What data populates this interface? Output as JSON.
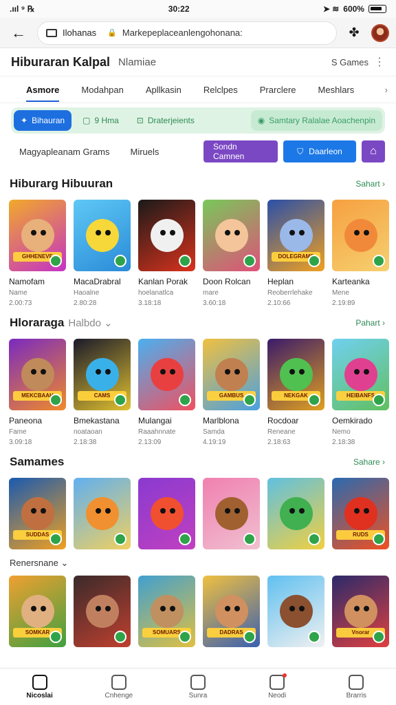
{
  "status": {
    "left": ".ııl ⁹ ℞",
    "time": "30:22",
    "right": "600%"
  },
  "browser": {
    "tab_title": "Ilohanas",
    "url": "Markepeplaceanlengohonana:",
    "back_icon": "arrow-left-icon",
    "extensions_icon": "puzzle-icon"
  },
  "site": {
    "title": "Hiburaran Kalpal",
    "subtitle": "Nlamiae",
    "count": "S Games",
    "menu_icon": "more-vertical-icon"
  },
  "tabs": [
    "Asmore",
    "Modahpan",
    "Apllkasin",
    "Relclpes",
    "Prarclere",
    "Meshlars"
  ],
  "chips": [
    {
      "label": "Bihauran",
      "style": "blue"
    },
    {
      "label": "9 Hma",
      "style": "plain"
    },
    {
      "label": "Draterjeients",
      "style": "plain"
    },
    {
      "label": "Samtary Ralalae Aoachenpin",
      "style": "soft"
    }
  ],
  "filter": {
    "left_a": "Magyapleanam Grams",
    "left_b": "Miruels",
    "btn_purple": "Sondn Camnen",
    "btn_blue": "Daarleon"
  },
  "sections": [
    {
      "title": "Hiburarg Hibuuran",
      "sub": "",
      "see_all": "Sahart ›",
      "games": [
        {
          "name": "Namofam",
          "sub": "Name",
          "meta": "2.00:73",
          "banner": "GHHENEVE",
          "bg1": "#f2a92a",
          "bg2": "#c433c4",
          "face": "#e8b07a"
        },
        {
          "name": "MacaDrabral",
          "sub": "Haoalne",
          "meta": "2.80:28",
          "banner": "",
          "bg1": "#5fc8f5",
          "bg2": "#2a8bd8",
          "face": "#f7d83a"
        },
        {
          "name": "Kanlan Porak",
          "sub": "hoelanatlca",
          "meta": "3.18:18",
          "banner": "",
          "bg1": "#1a1a1a",
          "bg2": "#d9321c",
          "face": "#f0f0f0"
        },
        {
          "name": "Doon Rolcan",
          "sub": "mare",
          "meta": "3.60:18",
          "banner": "",
          "bg1": "#78c85a",
          "bg2": "#e0507a",
          "face": "#f4c49a"
        },
        {
          "name": "Heplan",
          "sub": "Reoberrlehake",
          "meta": "2.10:66",
          "banner": "DOLEGRAMS",
          "bg1": "#2a4fa8",
          "bg2": "#f0a020",
          "face": "#9ab8e8"
        },
        {
          "name": "Karteanka",
          "sub": "Mene",
          "meta": "2.19:89",
          "banner": "",
          "bg1": "#f7a040",
          "bg2": "#f5d070",
          "face": "#f08a3a"
        }
      ]
    },
    {
      "title": "Hloraraga",
      "sub": "Halbdo ⌄",
      "see_all": "Pahart ›",
      "games": [
        {
          "name": "Paneona",
          "sub": "Fame",
          "meta": "3.09:18",
          "banner": "MEKCBAAH",
          "bg1": "#7a2ac0",
          "bg2": "#f08a2a",
          "face": "#c08a5a"
        },
        {
          "name": "Bmekastana",
          "sub": "noataoan",
          "meta": "2.18:38",
          "banner": "CAMS",
          "bg1": "#1a1a2a",
          "bg2": "#e0c030",
          "face": "#3ab0e8"
        },
        {
          "name": "Mulangai",
          "sub": "Raaahnnate",
          "meta": "2.13:09",
          "banner": "",
          "bg1": "#4ab0f0",
          "bg2": "#f05060",
          "face": "#e84040"
        },
        {
          "name": "Marlblona",
          "sub": "Samda",
          "meta": "4.19:19",
          "banner": "GAMBUS",
          "bg1": "#f0c040",
          "bg2": "#4aa0e0",
          "face": "#c08050"
        },
        {
          "name": "Rocdoar",
          "sub": "Reneane",
          "meta": "2.18:63",
          "banner": "NEKGAK",
          "bg1": "#3a1a6a",
          "bg2": "#e0a020",
          "face": "#50c050"
        },
        {
          "name": "Oemkirado",
          "sub": "Nemo",
          "meta": "2.18:38",
          "banner": "HEIBANFS",
          "bg1": "#70d0f0",
          "bg2": "#60c060",
          "face": "#e04090"
        }
      ]
    },
    {
      "title": "Samames",
      "sub": "",
      "see_all": "Sahare ›",
      "games": [
        {
          "name": "",
          "sub": "",
          "meta": "",
          "banner": "SUDDAS",
          "bg1": "#1a5ab0",
          "bg2": "#f0a020",
          "face": "#c07040"
        },
        {
          "name": "",
          "sub": "",
          "meta": "",
          "banner": "",
          "bg1": "#60b0f0",
          "bg2": "#f0d060",
          "face": "#f09030"
        },
        {
          "name": "",
          "sub": "",
          "meta": "",
          "banner": "",
          "bg1": "#8a3ad0",
          "bg2": "#c040c0",
          "face": "#f05030"
        },
        {
          "name": "",
          "sub": "",
          "meta": "",
          "banner": "",
          "bg1": "#f080b0",
          "bg2": "#f0c0d0",
          "face": "#a06030"
        },
        {
          "name": "",
          "sub": "",
          "meta": "",
          "banner": "",
          "bg1": "#60c0e0",
          "bg2": "#f0d040",
          "face": "#40b050"
        },
        {
          "name": "",
          "sub": "",
          "meta": "",
          "banner": "RUDS",
          "bg1": "#2a6ab0",
          "bg2": "#f05020",
          "face": "#e03020"
        }
      ]
    }
  ],
  "section3_sub": "Renersnane ⌄",
  "row4": [
    {
      "banner": "SOMKAR",
      "bg1": "#f0a030",
      "bg2": "#40a040",
      "face": "#e0b080"
    },
    {
      "banner": "",
      "bg1": "#3a2a2a",
      "bg2": "#c04030",
      "face": "#c08060"
    },
    {
      "banner": "SOMUARS",
      "bg1": "#40a0d0",
      "bg2": "#e0c040",
      "face": "#c09060"
    },
    {
      "banner": "DADRAS",
      "bg1": "#f0c040",
      "bg2": "#3a60b0",
      "face": "#d09060"
    },
    {
      "banner": "",
      "bg1": "#60c0f0",
      "bg2": "#f0f0f0",
      "face": "#8a5030"
    },
    {
      "banner": "Vnorar",
      "bg1": "#2a2a6a",
      "bg2": "#e04040",
      "face": "#d09060"
    }
  ],
  "bottom_nav": [
    {
      "label": "Nicoslai",
      "icon": "home-icon",
      "active": true
    },
    {
      "label": "Cnhenge",
      "icon": "compass-icon",
      "active": false
    },
    {
      "label": "Sunra",
      "icon": "upload-icon",
      "active": false
    },
    {
      "label": "Neodi",
      "icon": "store-icon",
      "active": false
    },
    {
      "label": "Brarris",
      "icon": "profile-icon",
      "active": false
    }
  ]
}
